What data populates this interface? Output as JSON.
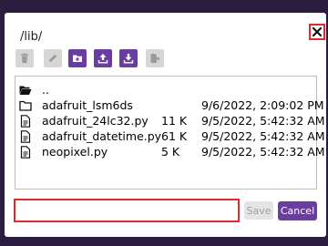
{
  "dialog": {
    "path": "/lib/",
    "close_icon": "close-icon"
  },
  "toolbar": {
    "buttons": [
      {
        "icon": "trash-icon",
        "enabled": false
      },
      {
        "icon": "pencil-icon",
        "enabled": false
      },
      {
        "icon": "new-folder-icon",
        "enabled": true
      },
      {
        "icon": "upload-icon",
        "enabled": true
      },
      {
        "icon": "download-icon",
        "enabled": true
      },
      {
        "icon": "move-file-icon",
        "enabled": false
      }
    ],
    "accent_color": "#6a3ea1",
    "disabled_color": "#d6d6d6"
  },
  "files": [
    {
      "icon": "open-folder-icon",
      "name": "..",
      "size": "",
      "date": ""
    },
    {
      "icon": "folder-icon",
      "name": "adafruit_lsm6ds",
      "size": "",
      "date": "9/6/2022, 2:09:02 PM"
    },
    {
      "icon": "file-icon",
      "name": "adafruit_24lc32.py",
      "size": "11 K",
      "date": "9/5/2022, 5:42:32 AM"
    },
    {
      "icon": "file-icon",
      "name": "adafruit_datetime.py",
      "size": "61 K",
      "date": "9/5/2022, 5:42:32 AM"
    },
    {
      "icon": "file-icon",
      "name": "neopixel.py",
      "size": "5 K",
      "date": "9/5/2022, 5:42:32 AM"
    }
  ],
  "footer": {
    "filename_value": "",
    "filename_placeholder": "",
    "save_label": "Save",
    "cancel_label": "Cancel"
  },
  "colors": {
    "highlight": "#e22828",
    "background": "#2a1d40"
  }
}
